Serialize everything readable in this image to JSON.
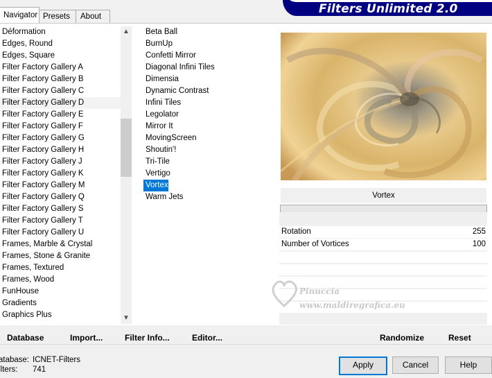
{
  "tabs": [
    {
      "label": "Navigator",
      "active": true
    },
    {
      "label": "Presets",
      "active": false
    },
    {
      "label": "About",
      "active": false
    }
  ],
  "banner_title": "Filters Unlimited 2.0",
  "categories": [
    "Déformation",
    "Edges, Round",
    "Edges, Square",
    "Filter Factory Gallery A",
    "Filter Factory Gallery B",
    "Filter Factory Gallery C",
    "Filter Factory Gallery D",
    "Filter Factory Gallery E",
    "Filter Factory Gallery F",
    "Filter Factory Gallery G",
    "Filter Factory Gallery H",
    "Filter Factory Gallery J",
    "Filter Factory Gallery K",
    "Filter Factory Gallery M",
    "Filter Factory Gallery Q",
    "Filter Factory Gallery S",
    "Filter Factory Gallery T",
    "Filter Factory Gallery U",
    "Frames, Marble & Crystal",
    "Frames, Stone & Granite",
    "Frames, Textured",
    "Frames, Wood",
    "FunHouse",
    "Gradients",
    "Graphics Plus"
  ],
  "highlighted_category": "Filter Factory Gallery D",
  "filters": [
    "Beta Ball",
    "BurnUp",
    "Confetti Mirror",
    "Diagonal Infini Tiles",
    "Dimensia",
    "Dynamic Contrast",
    "Infini Tiles",
    "Legolator",
    "Mirror It",
    "MovingScreen",
    "Shoutin'!",
    "Tri-Tile",
    "Vertigo",
    "Vortex",
    "Warm Jets"
  ],
  "selected_filter": "Vortex",
  "filter_name": "Vortex",
  "params": [
    {
      "label": "Rotation",
      "value": "255"
    },
    {
      "label": "Number of Vortices",
      "value": "100"
    }
  ],
  "links": {
    "database": "Database",
    "import": "Import...",
    "filter_info": "Filter Info...",
    "editor": "Editor...",
    "randomize": "Randomize",
    "reset": "Reset"
  },
  "status": {
    "database_label": "atabase:",
    "database_value": "ICNET-Filters",
    "filters_label": "ilters:",
    "filters_value": "741"
  },
  "buttons": {
    "apply": "Apply",
    "cancel": "Cancel",
    "help": "Help"
  },
  "watermark": {
    "line1": "Pinuccia",
    "line2": "www.maldiregrafica.eu"
  },
  "colors": {
    "selection": "#0078d7",
    "banner": "#000080",
    "apply_border": "#0078d7"
  }
}
